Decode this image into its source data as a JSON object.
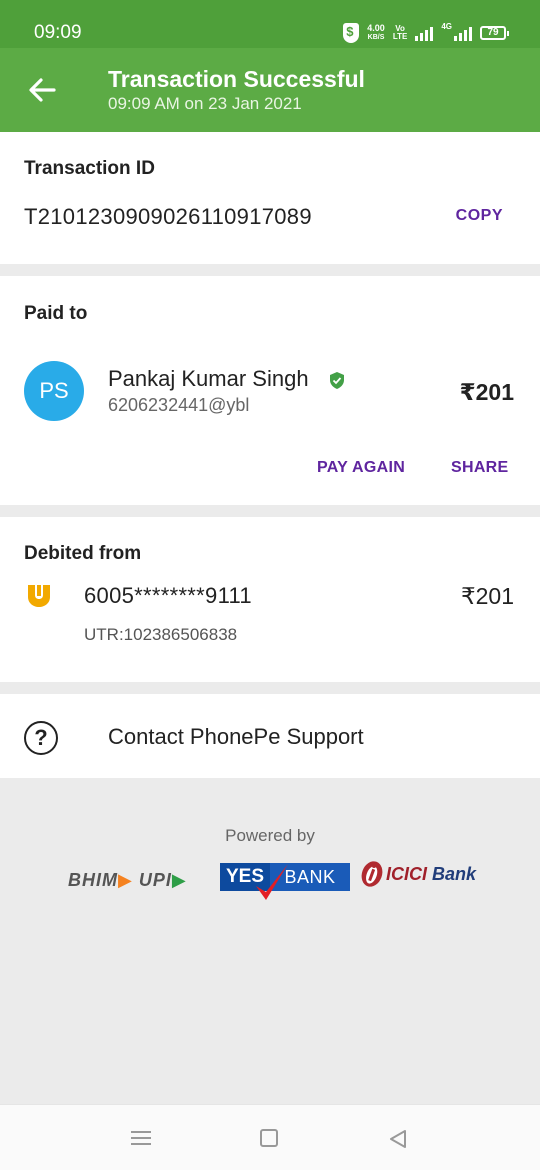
{
  "status_bar": {
    "time": "09:09",
    "speed_value": "4.00",
    "speed_unit": "KB/S",
    "volte_top": "Vo",
    "volte_bottom": "LTE",
    "network": "4G",
    "battery": "79"
  },
  "header": {
    "title": "Transaction Successful",
    "subtitle": "09:09 AM on 23 Jan 2021",
    "back_icon": "arrow-left-icon"
  },
  "transaction": {
    "label": "Transaction ID",
    "id": "T2101230909026110917089",
    "copy_label": "COPY"
  },
  "paid_to": {
    "label": "Paid to",
    "avatar_initials": "PS",
    "name": "Pankaj Kumar Singh",
    "vpa": "6206232441@ybl",
    "amount": "₹201",
    "pay_again_label": "PAY AGAIN",
    "share_label": "SHARE",
    "verified_icon": "verified-shield-icon"
  },
  "debited_from": {
    "label": "Debited from",
    "account": "6005********9111",
    "amount": "₹201",
    "utr": "UTR:102386506838",
    "bank_icon": "pnb-bank-icon"
  },
  "support": {
    "label": "Contact PhonePe Support",
    "icon": "help-circle-icon"
  },
  "footer": {
    "powered_by": "Powered by",
    "partners": {
      "bhim": "BHIM",
      "upi": "UPI",
      "yes": "YES",
      "bank": "BANK",
      "icici": "ICICI",
      "icici_bank": "Bank"
    }
  },
  "colors": {
    "header_green": "#5cab45",
    "status_green": "#4fa03a",
    "accent_purple": "#5f259f",
    "avatar_blue": "#29abe8"
  }
}
